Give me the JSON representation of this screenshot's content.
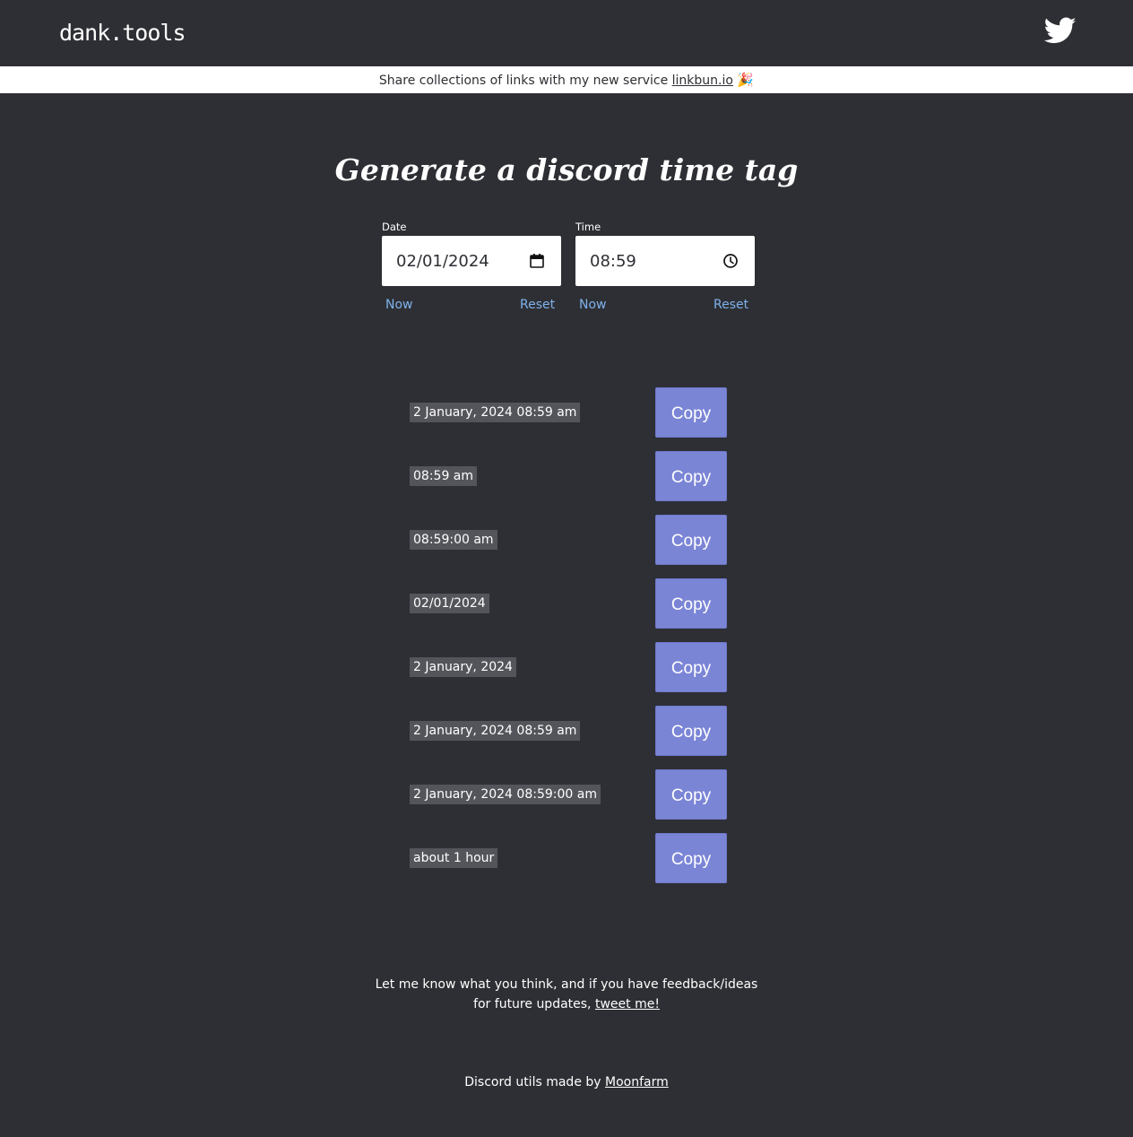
{
  "header": {
    "logo": "dank.tools",
    "twitter_icon": "twitter-bird-icon"
  },
  "banner": {
    "text": "Share collections of links with my new service ",
    "link": "linkbun.io",
    "emoji": "🎉"
  },
  "page": {
    "title": "Generate a discord time tag"
  },
  "date": {
    "label": "Date",
    "value": "02/01/2024",
    "icon": "calendar-icon",
    "now_label": "Now",
    "reset_label": "Reset"
  },
  "time": {
    "label": "Time",
    "value": "08:59",
    "icon": "clock-icon",
    "now_label": "Now",
    "reset_label": "Reset"
  },
  "tags": [
    {
      "text": "2 January, 2024 08:59 am",
      "button": "Copy"
    },
    {
      "text": "08:59 am",
      "button": "Copy"
    },
    {
      "text": "08:59:00 am",
      "button": "Copy"
    },
    {
      "text": "02/01/2024",
      "button": "Copy"
    },
    {
      "text": "2 January, 2024",
      "button": "Copy"
    },
    {
      "text": "2 January, 2024 08:59 am",
      "button": "Copy"
    },
    {
      "text": "2 January, 2024 08:59:00 am",
      "button": "Copy"
    },
    {
      "text": "about 1 hour",
      "button": "Copy"
    }
  ],
  "feedback": {
    "line1": "Let me know what you think, and if you have feedback/ideas",
    "line2": "for future updates, ",
    "link": "tweet me!"
  },
  "footer": {
    "text": "Discord utils made by ",
    "link": "Moonfarm"
  },
  "colors": {
    "background": "#2e2f34",
    "accent_button": "#7b85d6",
    "link_blue": "#7eb2ec",
    "tag_highlight": "#54555a"
  }
}
